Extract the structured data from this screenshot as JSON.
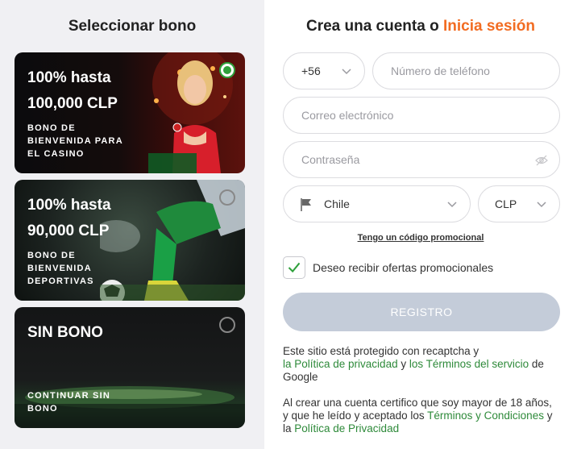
{
  "left": {
    "title": "Seleccionar bono",
    "cards": [
      {
        "line1": "100% hasta",
        "line2": "100,000 CLP",
        "sub1": "BONO DE",
        "sub2": "BIENVENIDA PARA",
        "sub3": "EL CASINO",
        "selected": true
      },
      {
        "line1": "100% hasta",
        "line2": "90,000 CLP",
        "sub1": "BONO DE",
        "sub2": "BIENVENIDA",
        "sub3": "DEPORTIVAS",
        "selected": false
      },
      {
        "line1": "SIN BONO",
        "sub1": "CONTINUAR SIN",
        "sub2": "BONO",
        "selected": false
      }
    ]
  },
  "right": {
    "title_prefix": "Crea una cuenta o ",
    "title_link": "Inicia sesión",
    "phone_code": "+56",
    "phone_placeholder": "Número de teléfono",
    "email_placeholder": "Correo electrónico",
    "password_placeholder": "Contraseña",
    "country": "Chile",
    "currency": "CLP",
    "promo_link": "Tengo un código promocional",
    "offers_label": "Deseo recibir ofertas promocionales",
    "offers_checked": true,
    "register_button": "REGISTRO",
    "recaptcha": {
      "text1": "Este sitio está protegido con recaptcha y",
      "link1": "la Política de privacidad",
      "text2": " y ",
      "link2": "los Términos del servicio",
      "text3": " de",
      "text4": "Google"
    },
    "age": {
      "text1": "Al crear una cuenta certifico que soy mayor de 18 años,",
      "text2": "y que he leído y aceptado los ",
      "link1": "Términos y Condiciones",
      "text3": " y",
      "text4": "la ",
      "link2": "Política de Privacidad"
    }
  },
  "colors": {
    "accent": "#f26c22",
    "green": "#2ea03b",
    "link_green": "#2e8a3a",
    "button_disabled": "#c4ccd9"
  }
}
